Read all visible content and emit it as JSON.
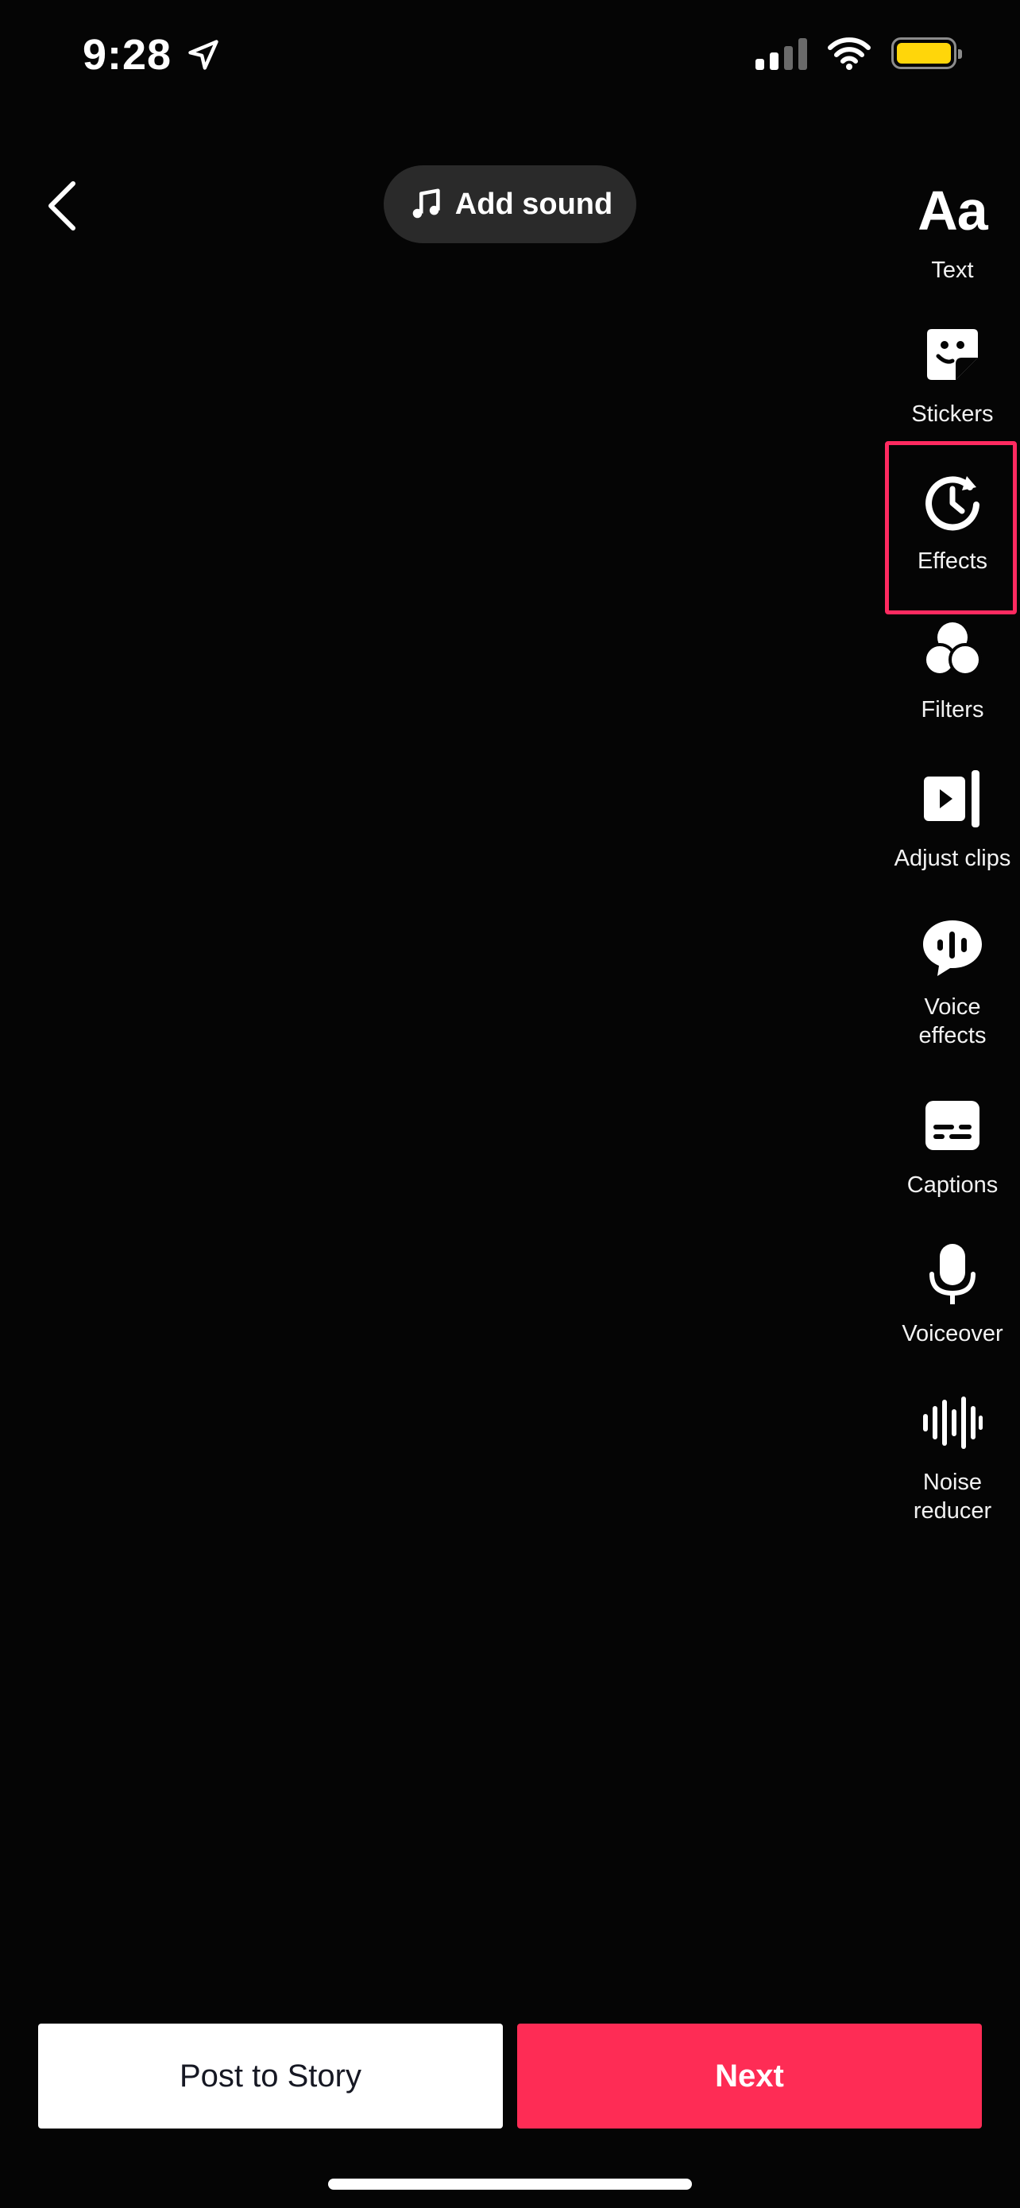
{
  "status_bar": {
    "time": "9:28"
  },
  "header": {
    "add_sound_label": "Add sound"
  },
  "tools": [
    {
      "label": "Text",
      "icon": "text-aa-icon",
      "glyph": "Aa"
    },
    {
      "label": "Stickers",
      "icon": "sticker-icon"
    },
    {
      "label": "Effects",
      "icon": "effects-clock-icon",
      "highlighted": true
    },
    {
      "label": "Filters",
      "icon": "filters-circles-icon"
    },
    {
      "label": "Adjust clips",
      "icon": "adjust-clips-icon"
    },
    {
      "label": "Voice\neffects",
      "icon": "voice-effects-icon"
    },
    {
      "label": "Captions",
      "icon": "captions-icon"
    },
    {
      "label": "Voiceover",
      "icon": "microphone-icon"
    },
    {
      "label": "Noise\nreducer",
      "icon": "noise-reducer-icon"
    }
  ],
  "footer": {
    "post_story_label": "Post to Story",
    "next_label": "Next"
  },
  "colors": {
    "accent": "#fe2c55",
    "highlight_border": "#ff2a60",
    "battery": "#ffd60a"
  }
}
